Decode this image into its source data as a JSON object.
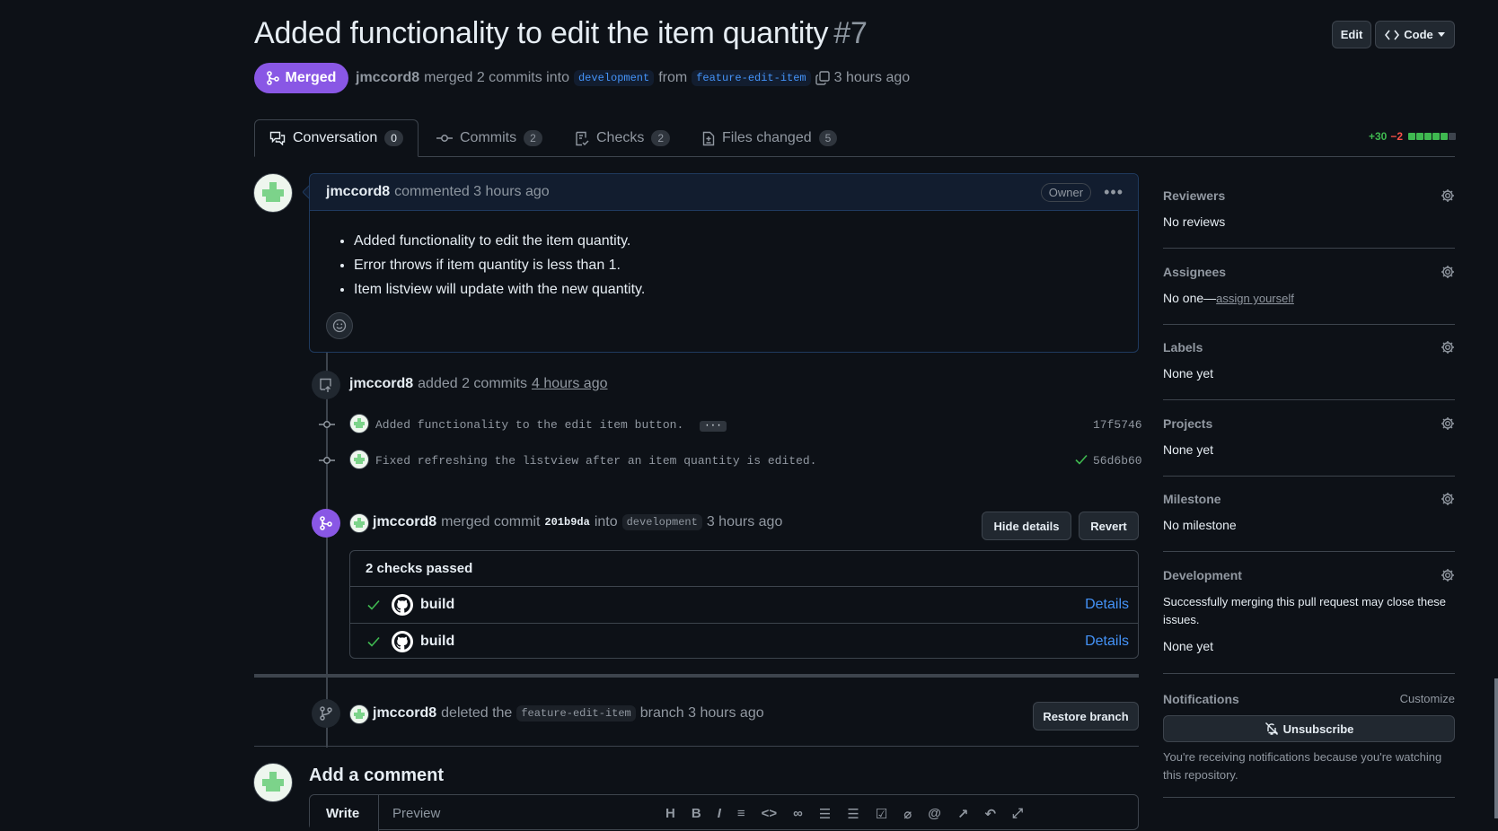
{
  "pr": {
    "title": "Added functionality to edit the item quantity",
    "number": "#7",
    "state": "Merged",
    "author": "jmccord8",
    "merged_text": "merged 2 commits into",
    "base_branch": "development",
    "from_text": "from",
    "head_branch": "feature-edit-item",
    "time": "3 hours ago"
  },
  "header_buttons": {
    "edit": "Edit",
    "code": "Code"
  },
  "tabs": [
    {
      "label": "Conversation",
      "count": "0"
    },
    {
      "label": "Commits",
      "count": "2"
    },
    {
      "label": "Checks",
      "count": "2"
    },
    {
      "label": "Files changed",
      "count": "5"
    }
  ],
  "diffstat": {
    "additions": "+30",
    "deletions": "−2"
  },
  "comment": {
    "author": "jmccord8",
    "action": "commented 3 hours ago",
    "role": "Owner",
    "items": [
      "Added functionality to edit the item quantity.",
      "Error throws if item quantity is less than 1.",
      "Item listview will update with the new quantity."
    ]
  },
  "commits_event": {
    "author": "jmccord8",
    "text": "added 2 commits",
    "time": "4 hours ago",
    "commits": [
      {
        "message": "Added functionality to the edit item button.",
        "sha": "17f5746",
        "expand": "···"
      },
      {
        "message": "Fixed refreshing the listview after an item quantity is edited.",
        "sha": "56d6b60"
      }
    ]
  },
  "merge_event": {
    "author": "jmccord8",
    "text": "merged commit",
    "commit": "201b9da",
    "into": "into",
    "branch": "development",
    "time": "3 hours ago",
    "hide_details": "Hide details",
    "revert": "Revert"
  },
  "checks": {
    "summary": "2 checks passed",
    "rows": [
      {
        "name": "build",
        "link": "Details"
      },
      {
        "name": "build",
        "link": "Details"
      }
    ]
  },
  "delete_event": {
    "author": "jmccord8",
    "text": "deleted the",
    "branch": "feature-edit-item",
    "suffix": "branch 3 hours ago",
    "restore": "Restore branch"
  },
  "add_comment": {
    "title": "Add a comment",
    "write": "Write",
    "preview": "Preview"
  },
  "sidebar": {
    "reviewers": {
      "label": "Reviewers",
      "value": "No reviews"
    },
    "assignees": {
      "label": "Assignees",
      "value": "No one—",
      "link": "assign yourself"
    },
    "labels": {
      "label": "Labels",
      "value": "None yet"
    },
    "projects": {
      "label": "Projects",
      "value": "None yet"
    },
    "milestone": {
      "label": "Milestone",
      "value": "No milestone"
    },
    "development": {
      "label": "Development",
      "description": "Successfully merging this pull request may close these issues.",
      "value": "None yet"
    },
    "notifications": {
      "label": "Notifications",
      "customize": "Customize",
      "unsubscribe": "Unsubscribe",
      "note": "You're receiving notifications because you're watching this repository."
    }
  }
}
